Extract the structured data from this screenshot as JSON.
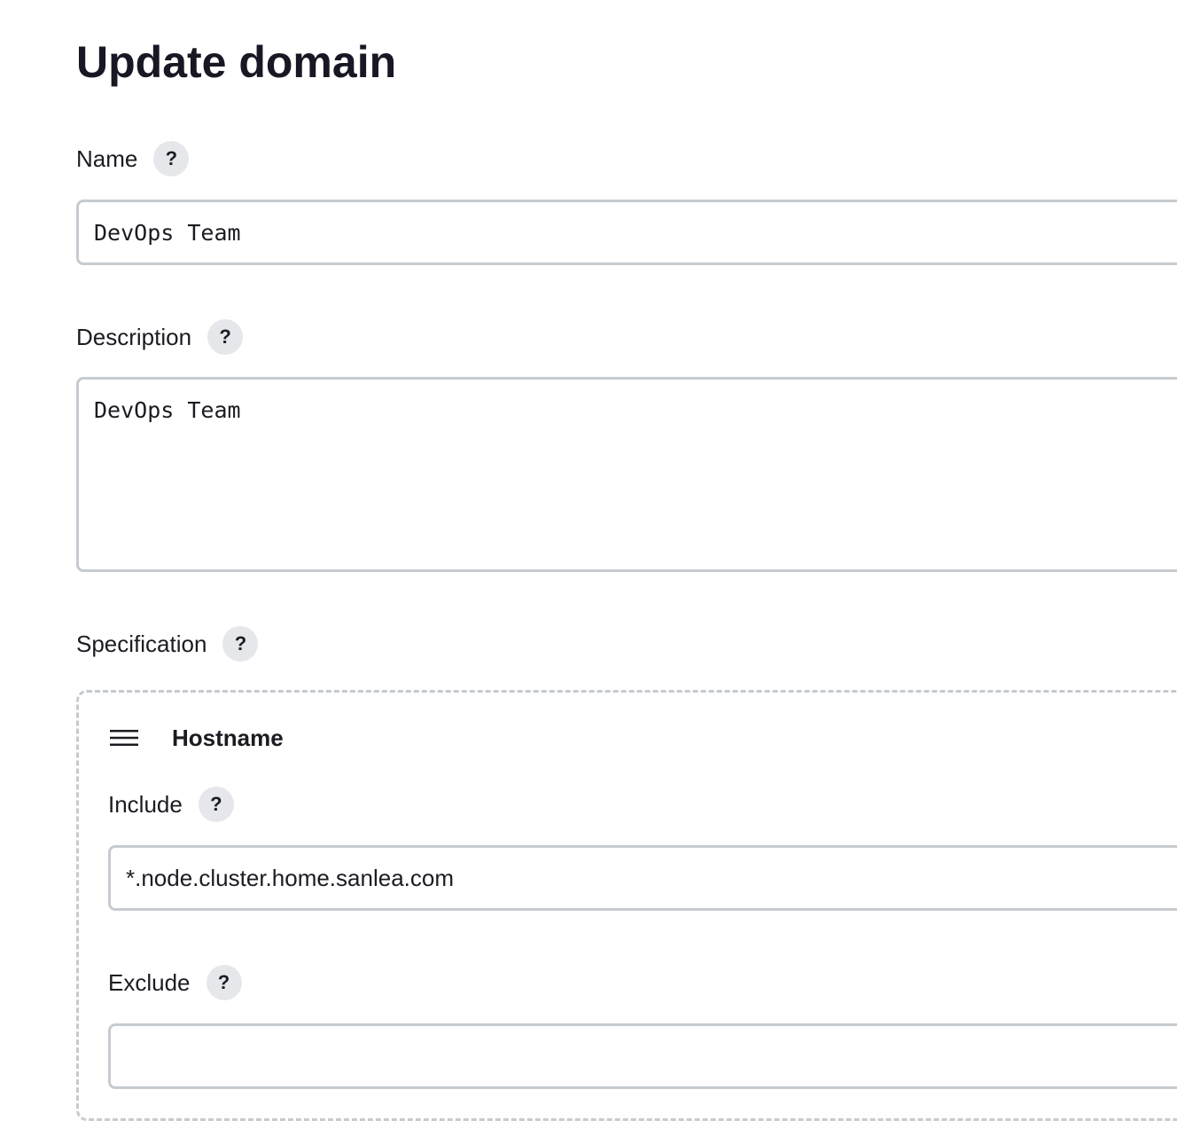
{
  "page": {
    "title": "Update domain"
  },
  "name_field": {
    "label": "Name",
    "help": "?",
    "value": "DevOps Team"
  },
  "description_field": {
    "label": "Description",
    "help": "?",
    "value": "DevOps Team"
  },
  "specification": {
    "label": "Specification",
    "help": "?",
    "block": {
      "icon": "drag-handle-icon",
      "title": "Hostname",
      "include": {
        "label": "Include",
        "help": "?",
        "value": "*.node.cluster.home.sanlea.com"
      },
      "exclude": {
        "label": "Exclude",
        "help": "?",
        "value": ""
      }
    }
  },
  "colors": {
    "border": "#c6cbd0",
    "help_bg": "#e6e7ea",
    "text": "#1b1b22"
  }
}
